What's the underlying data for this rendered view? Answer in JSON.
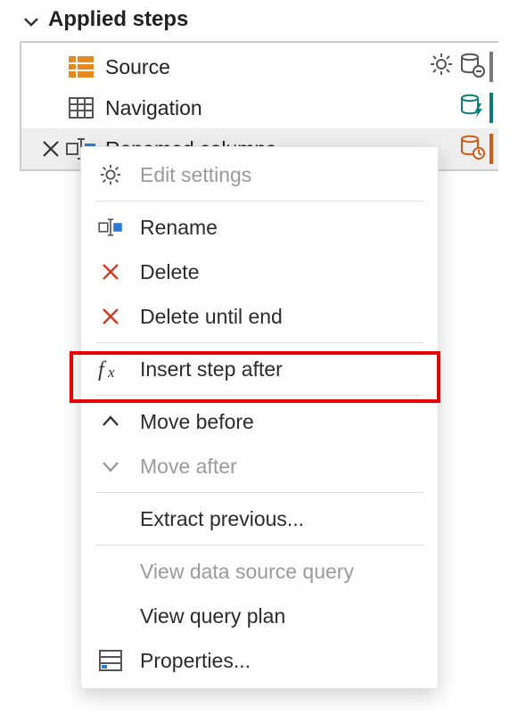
{
  "panel": {
    "title": "Applied steps"
  },
  "steps": [
    {
      "label": "Source",
      "icon": "source-table-icon",
      "gear": true,
      "db": "db-minus",
      "stripe": "gray",
      "selected": false,
      "deletable": false
    },
    {
      "label": "Navigation",
      "icon": "grid-icon",
      "gear": false,
      "db": "db-bolt",
      "stripe": "teal",
      "selected": false,
      "deletable": false
    },
    {
      "label": "Renamed columns",
      "icon": "rename-col-icon",
      "gear": false,
      "db": "db-clock",
      "stripe": "orange",
      "selected": true,
      "deletable": true
    }
  ],
  "menu": {
    "edit_settings": "Edit settings",
    "rename": "Rename",
    "delete": "Delete",
    "delete_until_end": "Delete until end",
    "insert_step_after": "Insert step after",
    "move_before": "Move before",
    "move_after": "Move after",
    "extract_previous": "Extract previous...",
    "view_ds_query": "View data source query",
    "view_query_plan": "View query plan",
    "properties": "Properties..."
  }
}
